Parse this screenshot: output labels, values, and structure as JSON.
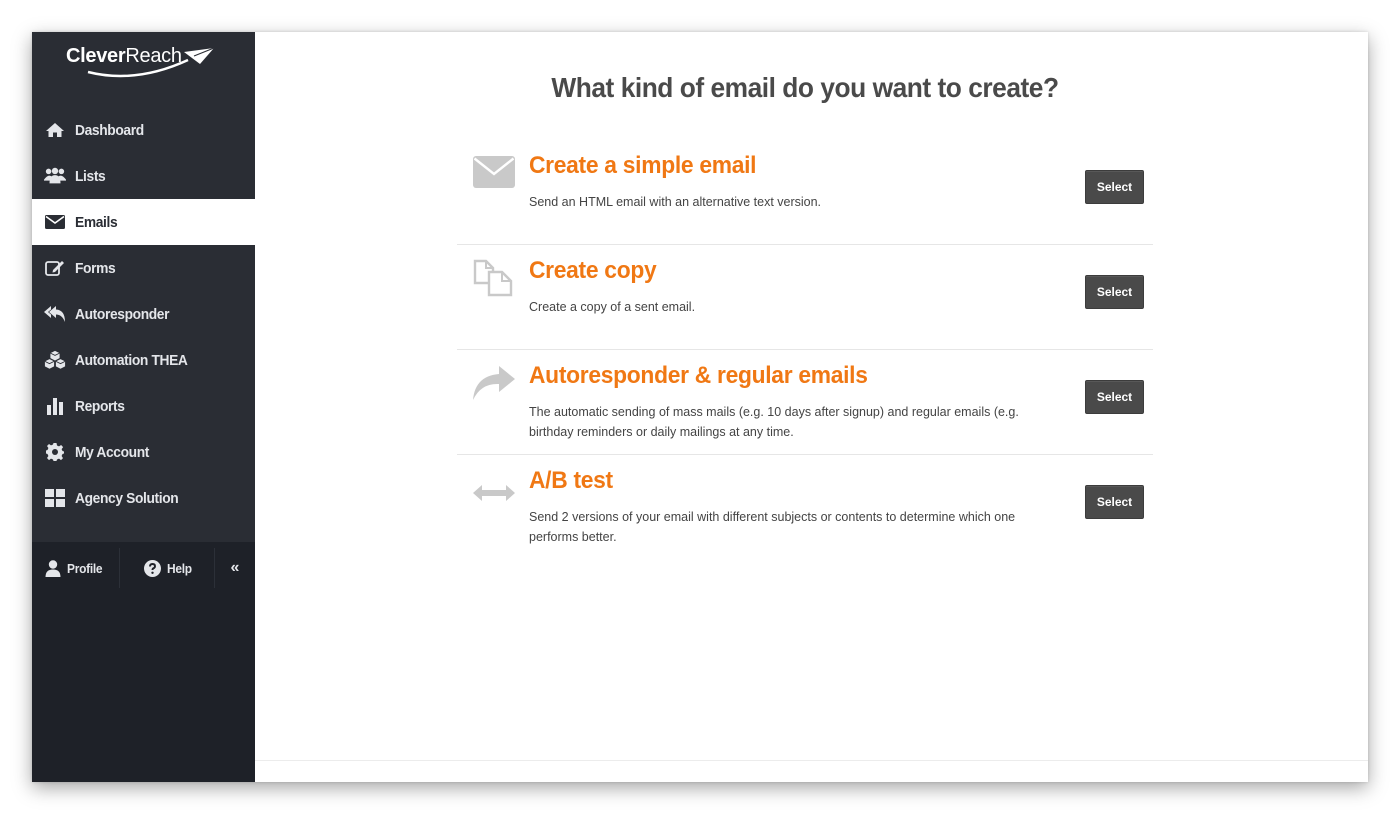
{
  "brand": {
    "name_bold": "Clever",
    "name_light": "Reach"
  },
  "sidebar": {
    "items": [
      {
        "label": "Dashboard",
        "icon": "home-icon"
      },
      {
        "label": "Lists",
        "icon": "users-icon"
      },
      {
        "label": "Emails",
        "icon": "envelope-icon",
        "active": true
      },
      {
        "label": "Forms",
        "icon": "edit-icon"
      },
      {
        "label": "Autoresponder",
        "icon": "reply-all-icon"
      },
      {
        "label": "Automation THEA",
        "icon": "cubes-icon"
      },
      {
        "label": "Reports",
        "icon": "bar-chart-icon"
      },
      {
        "label": "My Account",
        "icon": "gear-icon"
      },
      {
        "label": "Agency Solution",
        "icon": "grid-icon"
      }
    ],
    "bottom": {
      "profile_label": "Profile",
      "help_label": "Help",
      "collapse_symbol": "«"
    }
  },
  "main": {
    "title": "What kind of email do you want to create?",
    "options": [
      {
        "title": "Create a simple email",
        "description": "Send an HTML email with an alternative text version.",
        "button": "Select",
        "icon": "envelope-icon"
      },
      {
        "title": "Create copy",
        "description": "Create a copy of a sent email.",
        "button": "Select",
        "icon": "copy-icon"
      },
      {
        "title": "Autoresponder & regular emails",
        "description": "The automatic sending of mass mails (e.g. 10 days after signup) and regular emails (e.g. birthday reminders or daily mailings at any time.",
        "button": "Select",
        "icon": "share-arrow-icon"
      },
      {
        "title": "A/B test",
        "description": "Send 2 versions of your email with different subjects or contents to determine which one performs better.",
        "button": "Select",
        "icon": "arrows-horizontal-icon"
      }
    ]
  },
  "colors": {
    "accent": "#f07814",
    "sidebar": "#2a2d34",
    "sidebar_dark": "#1e2128",
    "button": "#4a4a4a"
  }
}
